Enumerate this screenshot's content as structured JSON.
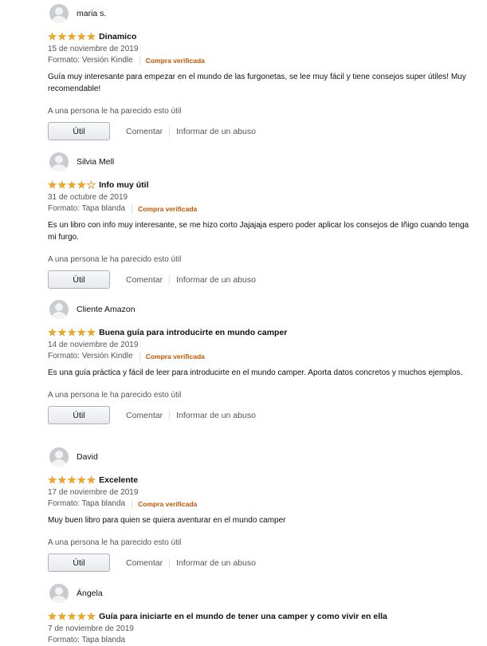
{
  "reviews": [
    {
      "author": "maria s.",
      "rating": 5,
      "title": "Dinamico",
      "date": "15 de noviembre de 2019",
      "format": "Formato: Versión Kindle",
      "verified": "Compra verificada",
      "body": "Guía muy interesante para empezar en el mundo de las furgonetas, se lee muy fácil y tiene consejos super útiles! Muy recomendable!",
      "helpful": "A una persona le ha parecido esto útil",
      "useful_label": "Útil",
      "comment_label": "Comentar",
      "report_label": "Informar de un abuso"
    },
    {
      "author": "Silvia Mell",
      "rating": 4,
      "title": "Info muy útil",
      "date": "31 de octubre de 2019",
      "format": "Formato: Tapa blanda",
      "verified": "Compra verificada",
      "body": "Es un libro con info muy interesante, se me hizo corto Jajajaja espero poder aplicar los consejos de Iñigo cuando tenga mi furgo.",
      "helpful": "A una persona le ha parecido esto útil",
      "useful_label": "Útil",
      "comment_label": "Comentar",
      "report_label": "Informar de un abuso"
    },
    {
      "author": "Cliente Amazon",
      "rating": 5,
      "title": "Buena guía para introducirte en mundo camper",
      "date": "14 de noviembre de 2019",
      "format": "Formato: Versión Kindle",
      "verified": "Compra verificada",
      "body": "Es una guía práctica y fácil de leer para introducirte en el mundo camper. Aporta datos concretos y muchos ejemplos.",
      "helpful": "A una persona le ha parecido esto útil",
      "useful_label": "Útil",
      "comment_label": "Comentar",
      "report_label": "Informar de un abuso"
    },
    {
      "author": "David",
      "rating": 5,
      "title": "Excelente",
      "date": "17 de noviembre de 2019",
      "format": "Formato: Tapa blanda",
      "verified": "Compra verificada",
      "body": "Muy buen libro para quien se quiera aventurar en el mundo camper",
      "helpful": "A una persona le ha parecido esto útil",
      "useful_label": "Útil",
      "comment_label": "Comentar",
      "report_label": "Informar de un abuso"
    },
    {
      "author": "Ángela",
      "rating": 5,
      "title": "Guía para iniciarte en el mundo de tener una camper y como vivir en ella",
      "date": "7 de noviembre de 2019",
      "format": "Formato: Tapa blanda"
    }
  ],
  "colors": {
    "star": "#f4a91c",
    "verified": "#c45500",
    "muted_text": "#555555",
    "button_border": "#adb1b8"
  },
  "icons": {
    "avatar": "avatar-icon",
    "star": "star-icon"
  }
}
